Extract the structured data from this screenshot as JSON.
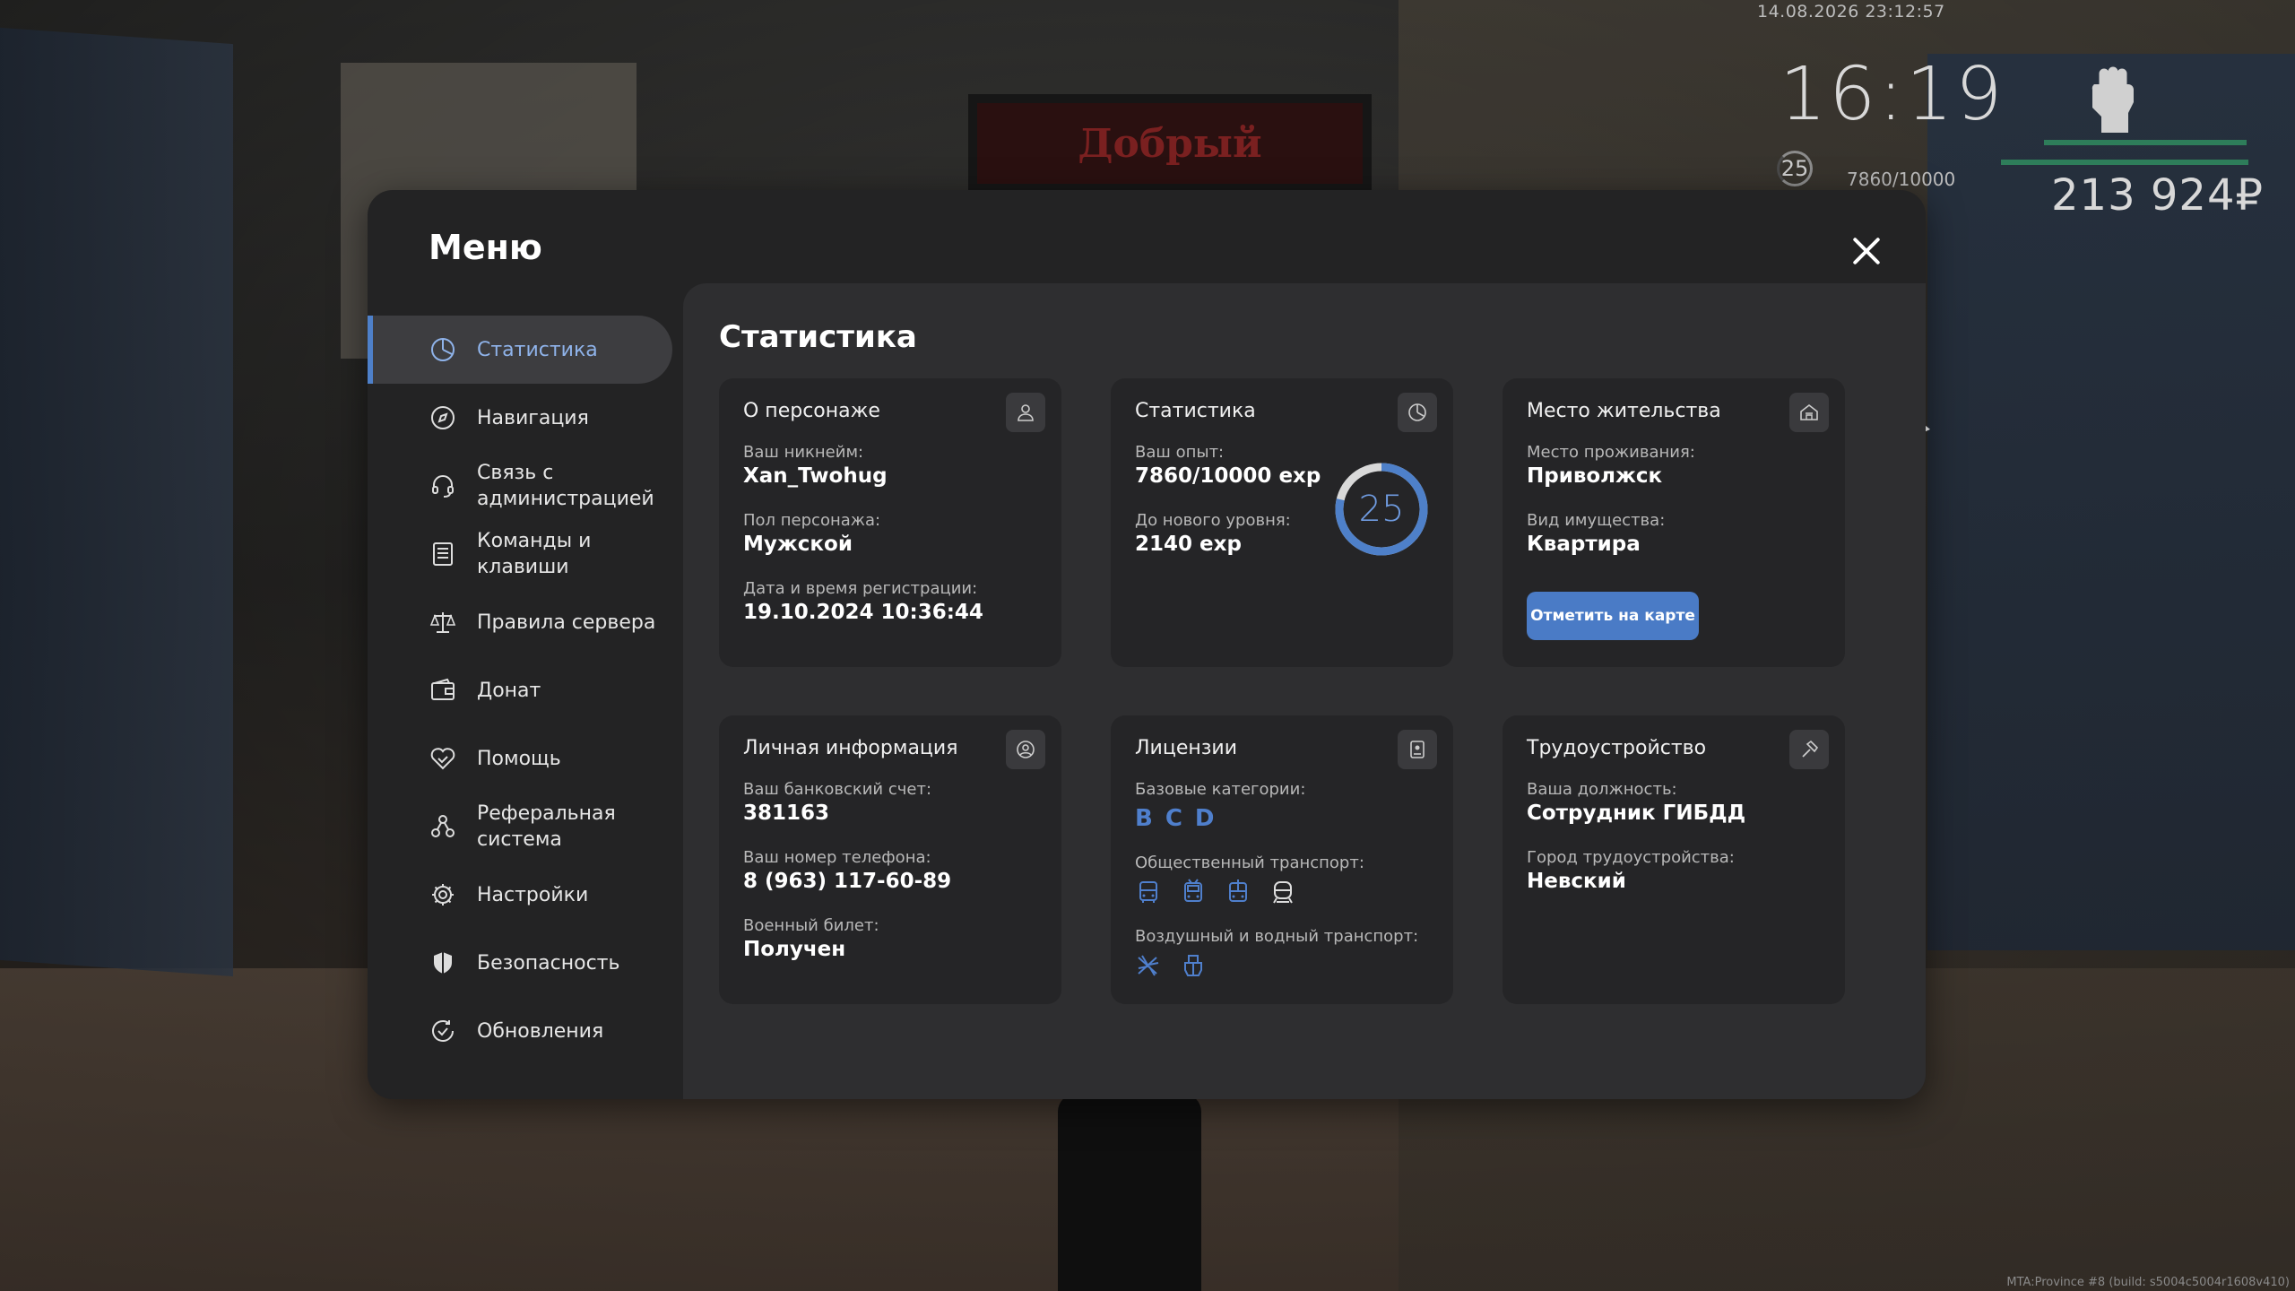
{
  "hud": {
    "datetime": "14.08.2026 23:12:57",
    "clock": "16:19",
    "level": "25",
    "exp": "7860/10000",
    "money": "213 924₽",
    "build": "MTA:Province #8 (build: s5004c5004r1608v410)"
  },
  "background": {
    "sign_text": "Добрый"
  },
  "menu": {
    "title": "Меню",
    "sidebar": [
      {
        "label": "Статистика",
        "icon": "stats-pie-icon",
        "active": true
      },
      {
        "label": "Навигация",
        "icon": "compass-icon",
        "active": false
      },
      {
        "label": "Связь с\nадминистрацией",
        "icon": "headset-icon",
        "active": false
      },
      {
        "label": "Команды и\nклавиши",
        "icon": "keyboard-list-icon",
        "active": false
      },
      {
        "label": "Правила сервера",
        "icon": "scales-icon",
        "active": false
      },
      {
        "label": "Донат",
        "icon": "wallet-icon",
        "active": false
      },
      {
        "label": "Помощь",
        "icon": "handshake-heart-icon",
        "active": false
      },
      {
        "label": "Реферальная\nсистема",
        "icon": "referral-nodes-icon",
        "active": false
      },
      {
        "label": "Настройки",
        "icon": "gear-icon",
        "active": false
      },
      {
        "label": "Безопасность",
        "icon": "shield-icon",
        "active": false
      },
      {
        "label": "Обновления",
        "icon": "refresh-check-icon",
        "active": false
      }
    ],
    "content_title": "Статистика",
    "cards": {
      "character": {
        "title": "О персонаже",
        "icon": "user-icon",
        "nickname_label": "Ваш никнейм:",
        "nickname": "Xan_Twohug",
        "gender_label": "Пол персонажа:",
        "gender": "Мужской",
        "reg_label": "Дата и время регистрации:",
        "reg": "19.10.2024 10:36:44"
      },
      "stats": {
        "title": "Статистика",
        "icon": "clock-pie-icon",
        "exp_label": "Ваш опыт:",
        "exp": "7860/10000 exp",
        "next_label": "До нового уровня:",
        "next": "2140 exp",
        "level": "25",
        "progress": 0.786
      },
      "residence": {
        "title": "Место жительства",
        "icon": "house-icon",
        "place_label": "Место проживания:",
        "place": "Приволжск",
        "property_label": "Вид имущества:",
        "property": "Квартира",
        "map_button": "Отметить на карте"
      },
      "personal": {
        "title": "Личная информация",
        "icon": "user-circle-icon",
        "bank_label": "Ваш банковский счет:",
        "bank": "381163",
        "phone_label": "Ваш номер телефона:",
        "phone": "8 (963) 117-60-89",
        "military_label": "Военный билет:",
        "military": "Получен"
      },
      "licenses": {
        "title": "Лицензии",
        "icon": "license-card-icon",
        "base_label": "Базовые категории:",
        "base": [
          "B",
          "C",
          "D"
        ],
        "public_label": "Общественный транспорт:",
        "air_label": "Воздушный и водный транспорт:"
      },
      "job": {
        "title": "Трудоустройство",
        "icon": "hammer-icon",
        "position_label": "Ваша должность:",
        "position": "Сотрудник ГИБДД",
        "city_label": "Город трудоустройства:",
        "city": "Невский"
      }
    }
  }
}
